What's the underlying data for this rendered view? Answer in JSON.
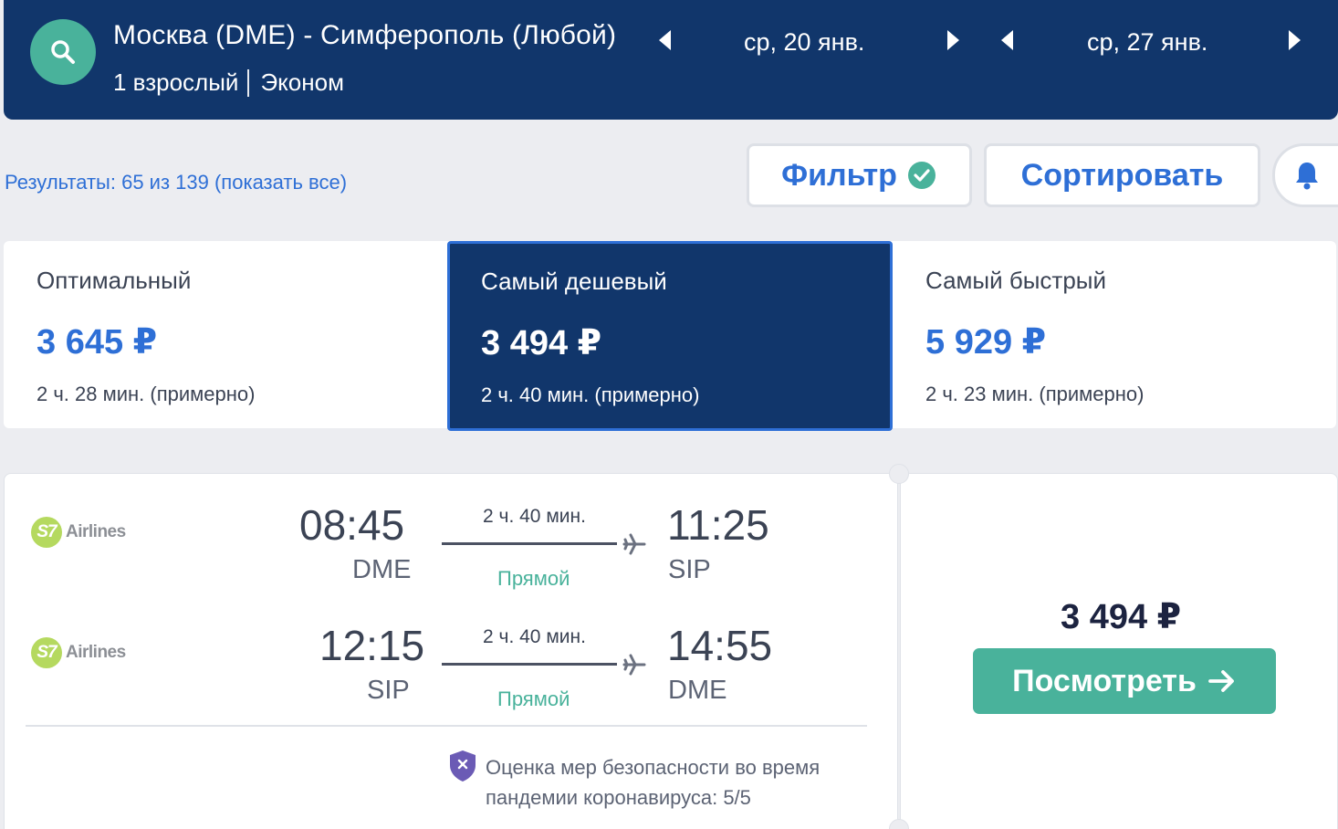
{
  "header": {
    "route": "Москва (DME) - Симферополь (Любой)",
    "passengers": "1 взрослый",
    "cabin": "Эконом",
    "depart_date": "ср, 20 янв.",
    "return_date": "ср, 27 янв."
  },
  "toolbar": {
    "results": "Результаты: 65 из 139 (показать все)",
    "filter_label": "Фильтр",
    "sort_label": "Сортировать"
  },
  "sort_options": [
    {
      "title": "Оптимальный",
      "price": "3 645 ₽",
      "duration": "2 ч. 28 мин. (примерно)"
    },
    {
      "title": "Самый дешевый",
      "price": "3 494 ₽",
      "duration": "2 ч. 40 мин. (примерно)"
    },
    {
      "title": "Самый быстрый",
      "price": "5 929 ₽",
      "duration": "2 ч. 23 мин. (примерно)"
    }
  ],
  "result": {
    "legs": [
      {
        "airline": "Airlines",
        "airline_mark": "S7",
        "dep_time": "08:45",
        "dep_code": "DME",
        "duration": "2 ч. 40 мин.",
        "stops": "Прямой",
        "arr_time": "11:25",
        "arr_code": "SIP"
      },
      {
        "airline": "Airlines",
        "airline_mark": "S7",
        "dep_time": "12:15",
        "dep_code": "SIP",
        "duration": "2 ч. 40 мин.",
        "stops": "Прямой",
        "arr_time": "14:55",
        "arr_code": "DME"
      }
    ],
    "safety_line1": "Оценка мер безопасности во время",
    "safety_line2": "пандемии коронавируса: 5/5",
    "price": "3 494 ₽",
    "view_label": "Посмотреть"
  },
  "colors": {
    "header_bg": "#11366b",
    "accent_blue": "#2e6fd6",
    "accent_green": "#49b29b",
    "page_bg": "#ecedf1",
    "shield_purple": "#6b5bb5"
  },
  "icons": [
    "search-icon",
    "chevron-left-icon",
    "chevron-right-icon",
    "check-circle-icon",
    "bell-icon",
    "plane-icon",
    "shield-icon",
    "arrow-right-icon"
  ]
}
